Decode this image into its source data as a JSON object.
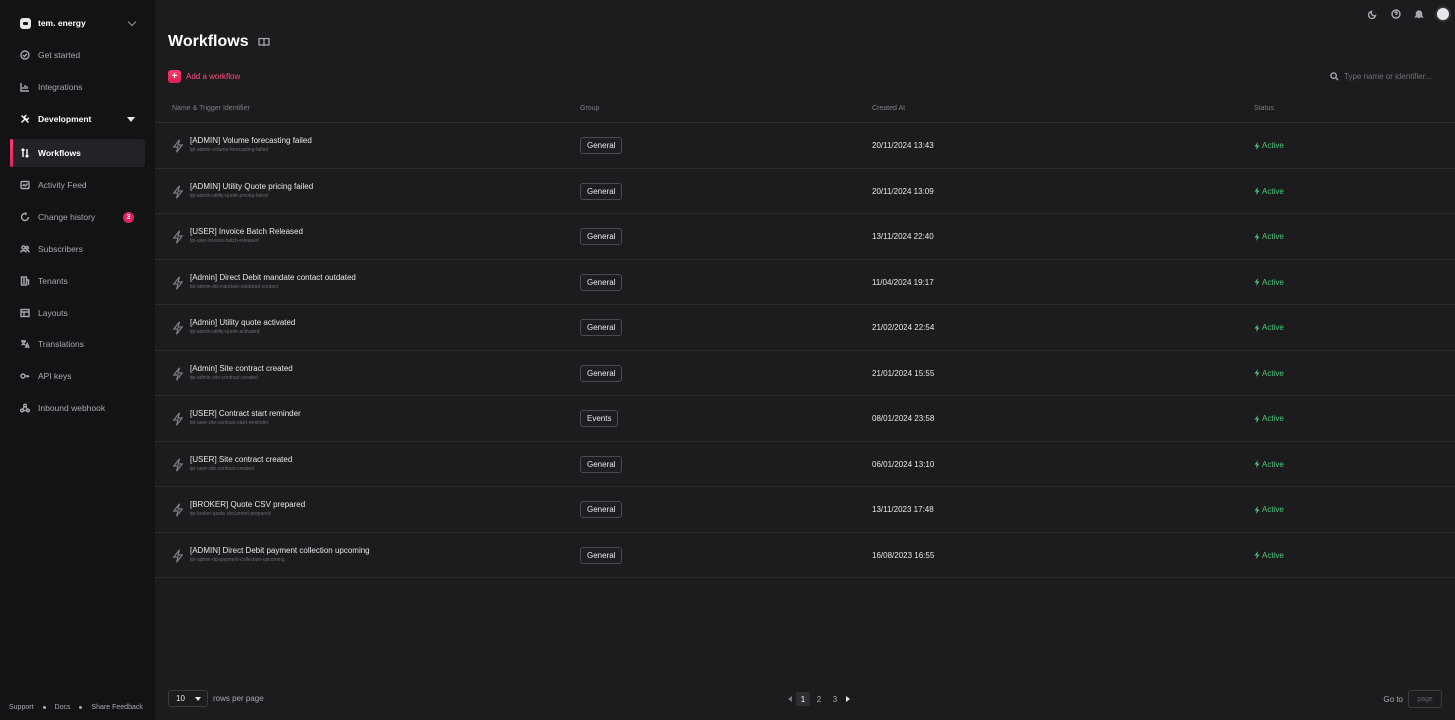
{
  "org": {
    "name": "tem. energy"
  },
  "nav": {
    "get_started": "Get started",
    "integrations": "Integrations",
    "development": "Development",
    "workflows": "Workflows",
    "activity_feed": "Activity Feed",
    "change_history": "Change history",
    "change_history_badge": "3",
    "subscribers": "Subscribers",
    "tenants": "Tenants",
    "layouts": "Layouts",
    "translations": "Translations",
    "api_keys": "API keys",
    "inbound_webhook": "Inbound webhook"
  },
  "footer": {
    "support": "Support",
    "docs": "Docs",
    "feedback": "Share Feedback"
  },
  "page": {
    "title": "Workflows",
    "add_label": "Add a workflow",
    "search_placeholder": "Type name or identifier..."
  },
  "table": {
    "headers": {
      "name": "Name & Trigger Identifier",
      "group": "Group",
      "created": "Created At",
      "status": "Status"
    },
    "rows": [
      {
        "name": "[ADMIN] Volume forecasting failed",
        "trigger": "tpi-admin-volume-forecasting-failed",
        "group": "General",
        "created": "20/11/2024 13:43",
        "status": "Active"
      },
      {
        "name": "[ADMIN] Utility Quote pricing failed",
        "trigger": "tpi-admin-utility-quote-pricing-failed",
        "group": "General",
        "created": "20/11/2024 13:09",
        "status": "Active"
      },
      {
        "name": "[USER] Invoice Batch Released",
        "trigger": "tpi-user-invoice-batch-released",
        "group": "General",
        "created": "13/11/2024 22:40",
        "status": "Active"
      },
      {
        "name": "[Admin] Direct Debit mandate contact outdated",
        "trigger": "tpi-admin-dd-mandate-outdated-contact",
        "group": "General",
        "created": "11/04/2024 19:17",
        "status": "Active"
      },
      {
        "name": "[Admin] Utility quote activated",
        "trigger": "tpi-admin-utility-quote-activated",
        "group": "General",
        "created": "21/02/2024 22:54",
        "status": "Active"
      },
      {
        "name": "[Admin] Site contract created",
        "trigger": "tpi-admin-site-contract-created",
        "group": "General",
        "created": "21/01/2024 15:55",
        "status": "Active"
      },
      {
        "name": "[USER] Contract start reminder",
        "trigger": "tpi-user-site-contract-start-reminder",
        "group": "Events",
        "created": "08/01/2024 23:58",
        "status": "Active"
      },
      {
        "name": "[USER] Site contract created",
        "trigger": "tpi-user-site-contract-created",
        "group": "General",
        "created": "06/01/2024 13:10",
        "status": "Active"
      },
      {
        "name": "[BROKER] Quote CSV prepared",
        "trigger": "tpi-broker-quote-document-prepared",
        "group": "General",
        "created": "13/11/2023 17:48",
        "status": "Active"
      },
      {
        "name": "[ADMIN] Direct Debit payment collection upcoming",
        "trigger": "tpi-admin-dd-payment-collection-upcoming",
        "group": "General",
        "created": "16/08/2023 16:55",
        "status": "Active"
      }
    ]
  },
  "pagination": {
    "page_size": "10",
    "rows_per_page": "rows per page",
    "pages": [
      "1",
      "2",
      "3"
    ],
    "current_page": "1",
    "goto_label": "Go to",
    "goto_placeholder": "page"
  },
  "colors": {
    "accent": "#e0245e",
    "status_active": "#4ec47a",
    "background": "#1c1c1f",
    "sidebar": "#131316"
  }
}
